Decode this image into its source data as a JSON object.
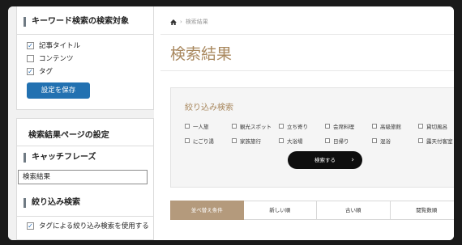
{
  "settings": {
    "search_target": {
      "title": "キーワード検索の検索対象",
      "options": [
        {
          "label": "記事タイトル",
          "checked": true
        },
        {
          "label": "コンテンツ",
          "checked": false
        },
        {
          "label": "タグ",
          "checked": true
        }
      ],
      "save_label": "設定を保存"
    },
    "results_page": {
      "title": "検索結果ページの設定",
      "catchphrase_heading": "キャッチフレーズ",
      "catchphrase_value": "検索結果",
      "filter_heading": "絞り込み検索",
      "tag_filter_label": "タグによる絞り込み検索を使用する",
      "tag_filter_checked": true
    }
  },
  "preview": {
    "breadcrumb": "検索結果",
    "page_title": "検索結果",
    "filter_title": "絞り込み検索",
    "tags_row1": [
      "一人旅",
      "観光スポット",
      "立ち寄り",
      "会席料理",
      "高級旅館",
      "貸切風呂"
    ],
    "tags_row2": [
      "にごり湯",
      "家族旅行",
      "大浴場",
      "日帰り",
      "混浴",
      "露天付客室"
    ],
    "search_button": "検索する",
    "sort_tabs": [
      "並べ替え条件",
      "新しい順",
      "古い順",
      "閲覧数順"
    ]
  },
  "colors": {
    "accent": "#a8875d",
    "save_button": "#2271b1",
    "sort_active": "#b49a7c"
  }
}
